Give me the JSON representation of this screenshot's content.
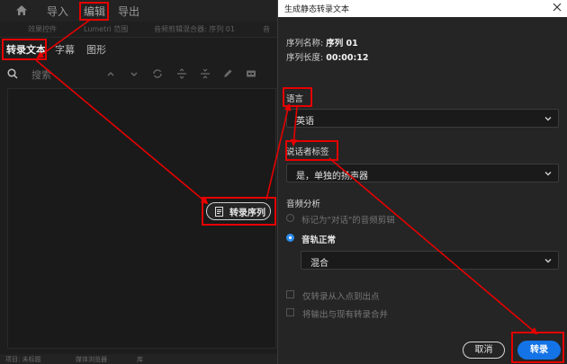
{
  "app": {
    "menu": [
      "导入",
      "编辑",
      "导出"
    ],
    "panel_tabs": [
      "效果控件",
      "Lumetri 范围",
      "音频剪辑混合器: 序列 01",
      "音"
    ],
    "sub_tabs": [
      "转录文本",
      "字幕",
      "图形"
    ],
    "search_placeholder": "搜索",
    "transcribe_sequence_label": "转录序列",
    "bottom_tabs": [
      "项目: 未标题",
      "媒体浏览器",
      "库"
    ]
  },
  "dialog": {
    "title": "生成静态转录文本",
    "sequence_name_label": "序列名称:",
    "sequence_name": "序列 01",
    "sequence_length_label": "序列长度:",
    "sequence_length": "00:00:12",
    "language_label": "语言",
    "language_value": "英语",
    "speaker_label": "说话者标签",
    "speaker_value": "是，单独的扬声器",
    "audio_analysis_label": "音频分析",
    "radio_clips_label": "标记为\"对话\"的音频剪辑",
    "radio_track_label": "音轨正常",
    "track_value": "混合",
    "check_in_out_label": "仅转录从入点到出点",
    "check_merge_label": "将输出与现有转录合并",
    "cancel_label": "取消",
    "transcribe_label": "转录"
  },
  "colors": {
    "annotation": "#e60000",
    "primary_button": "#1473e6",
    "radio_selected": "#2d8ceb"
  }
}
